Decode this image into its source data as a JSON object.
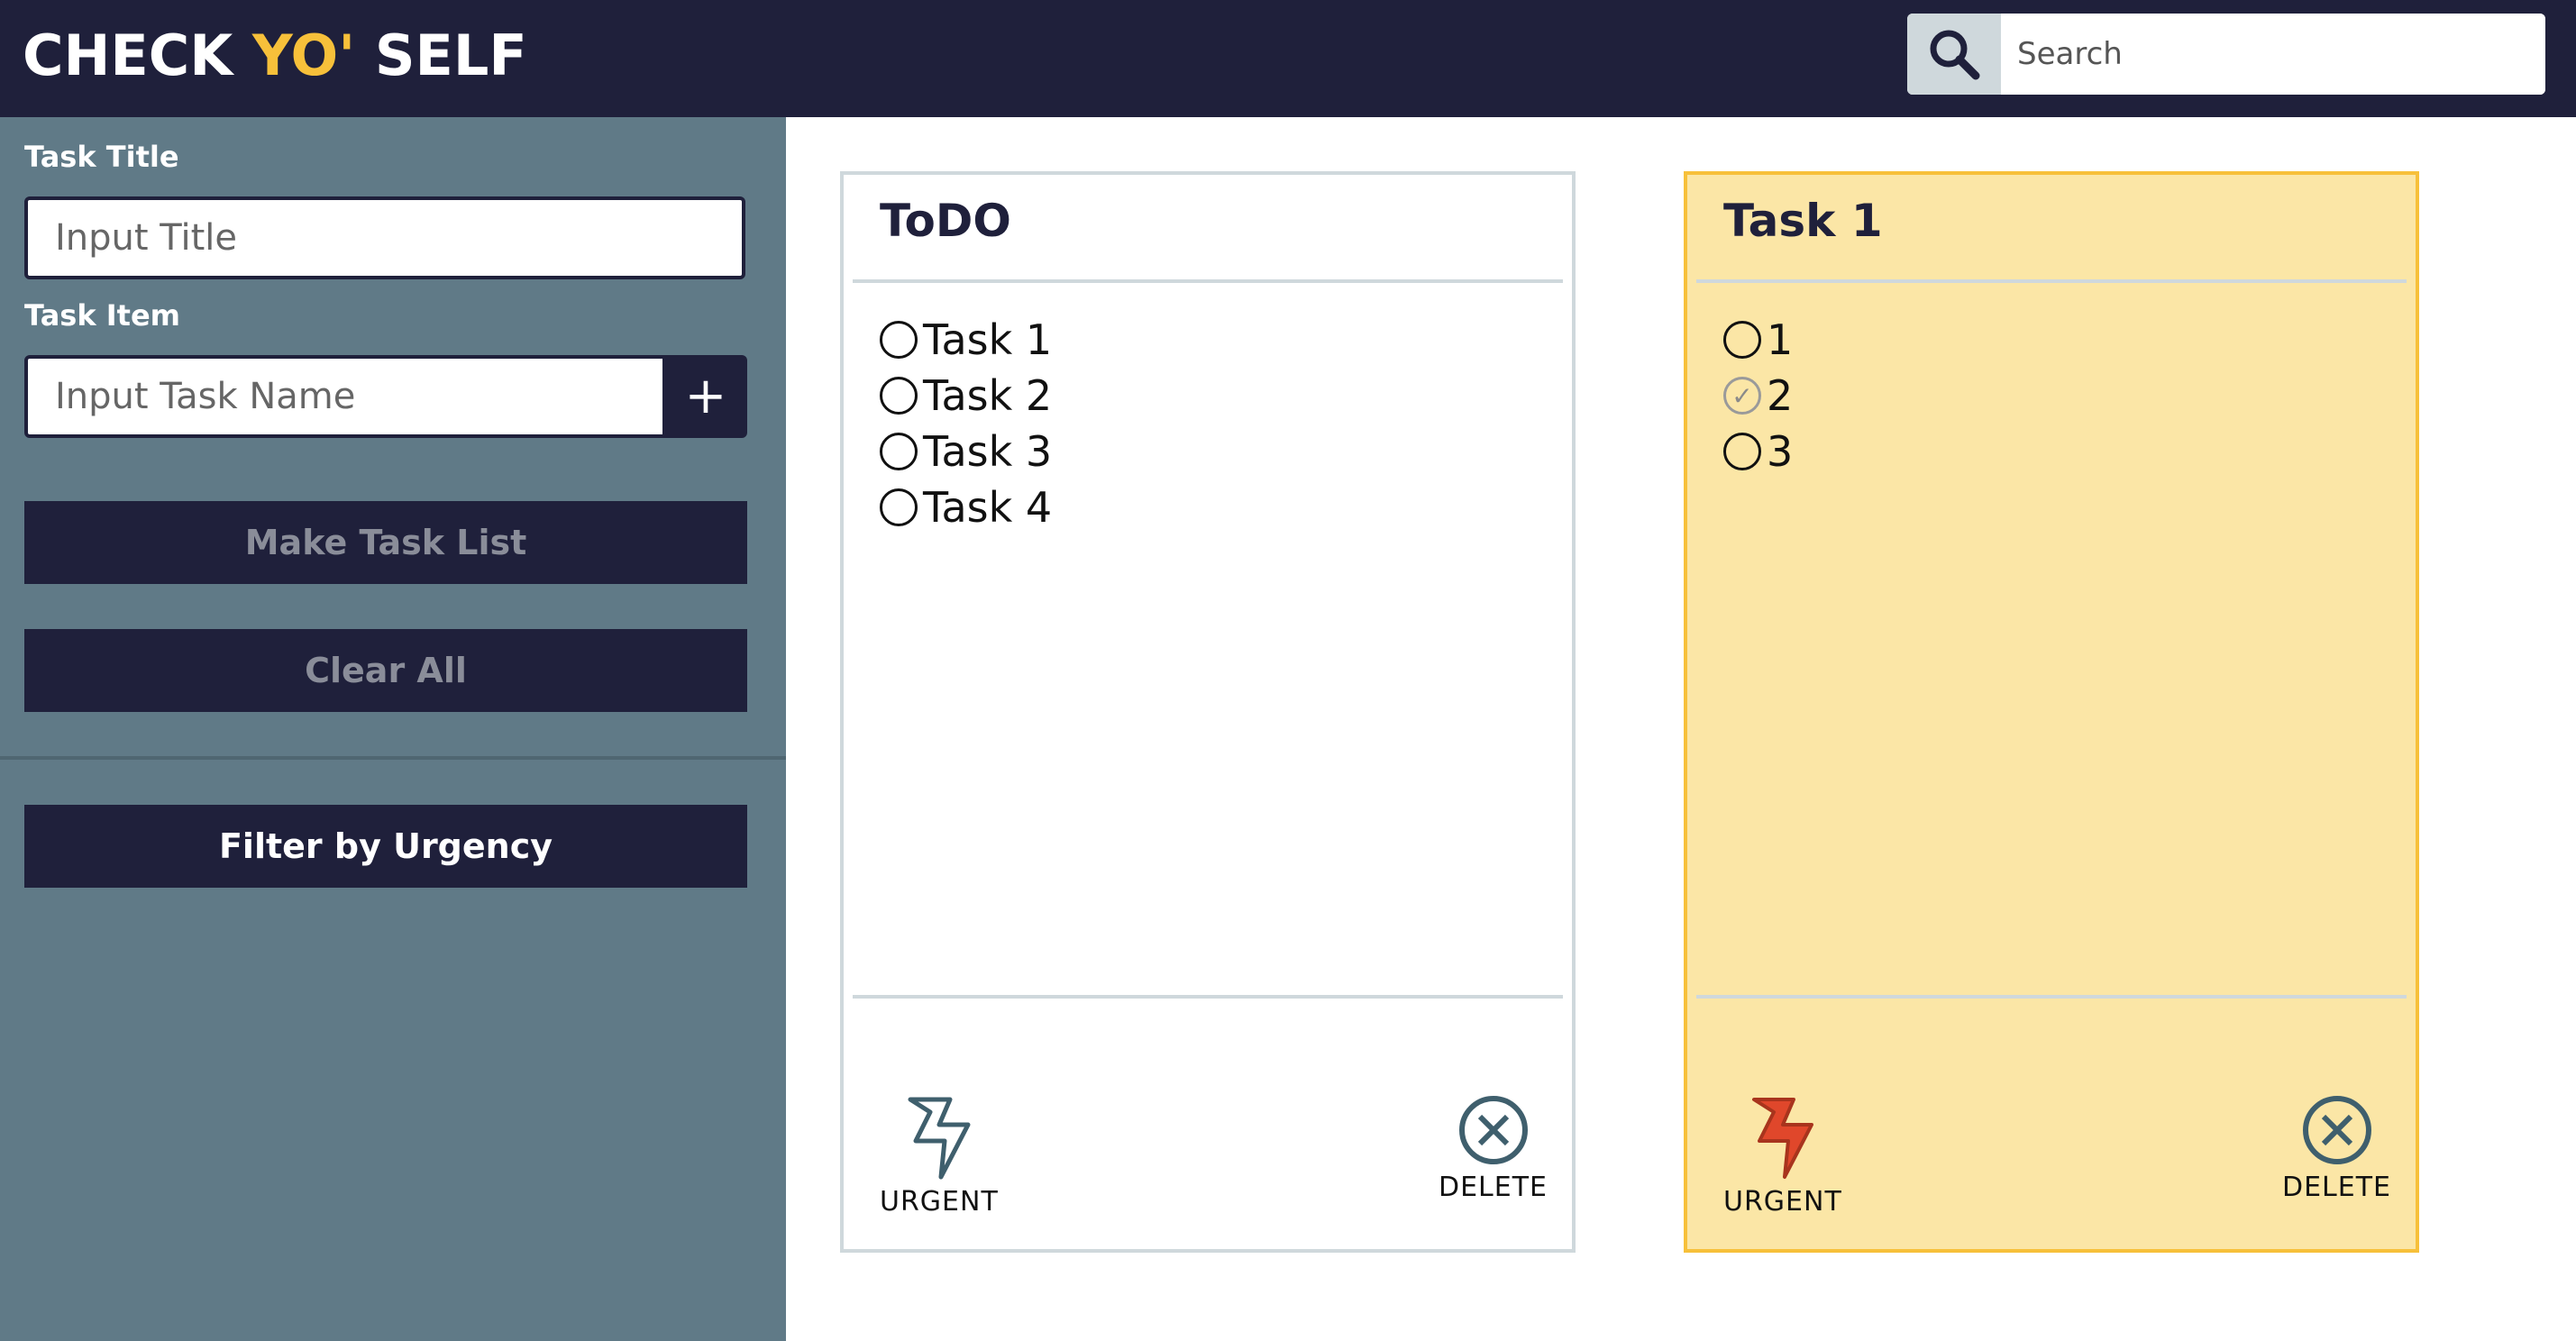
{
  "header": {
    "logo_part1": "CHECK ",
    "logo_accent": "YO'",
    "logo_part2": " SELF",
    "search_placeholder": "Search",
    "search_icon": "magnifier-icon"
  },
  "sidebar": {
    "task_title_label": "Task Title",
    "task_title_placeholder": "Input Title",
    "task_item_label": "Task Item",
    "task_item_placeholder": "Input Task Name",
    "add_label": "+",
    "make_list_label": "Make Task List",
    "clear_all_label": "Clear All",
    "filter_label": "Filter by Urgency"
  },
  "cards": [
    {
      "title": "ToDO",
      "urgent": false,
      "tasks": [
        {
          "label": "Task 1",
          "checked": false
        },
        {
          "label": "Task 2",
          "checked": false
        },
        {
          "label": "Task 3",
          "checked": false
        },
        {
          "label": "Task 4",
          "checked": false
        }
      ],
      "urgent_label": "URGENT",
      "delete_label": "DELETE"
    },
    {
      "title": "Task 1",
      "urgent": true,
      "tasks": [
        {
          "label": "1",
          "checked": false
        },
        {
          "label": "2",
          "checked": true
        },
        {
          "label": "3",
          "checked": false
        }
      ],
      "urgent_label": "URGENT",
      "delete_label": "DELETE"
    }
  ],
  "colors": {
    "navy": "#1f203b",
    "accent_yellow": "#f7c03a",
    "sidebar": "#607a87",
    "urgent_card": "#fbe6a6",
    "urgent_icon": "#e0472b"
  }
}
